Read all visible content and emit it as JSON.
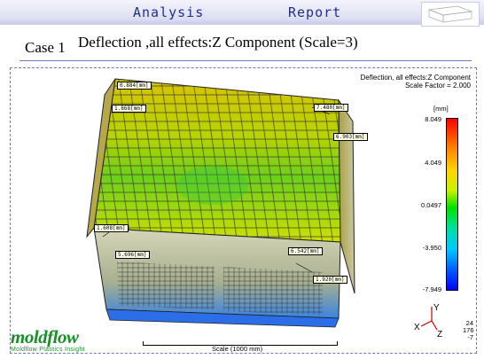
{
  "header": {
    "left_tab": "Analysis",
    "right_tab": "Report"
  },
  "title": {
    "case_label": "Case 1",
    "main": "Deflection ,all effects:Z Component (Scale=3)"
  },
  "result": {
    "title_line1": "Deflection, all effects:Z Component",
    "title_line2": "Scale Factor = 2.000",
    "unit": "[mm]",
    "legend_max": "8.049",
    "legend_ticks": [
      "8.049",
      "4.049",
      "0.0497",
      "-3.950",
      "-7.949"
    ],
    "probes": [
      "0.884[mm]",
      "1.868[mm]",
      "7.480[mm]",
      "6.903[mm]",
      "1.608[mm]",
      "5.696[mm]",
      "6.542[mm]",
      "1.920[mm]"
    ],
    "scale_text": "Scale (1000 mm)",
    "rotation": [
      "24",
      "176",
      "-7"
    ],
    "axis_labels": {
      "x": "X",
      "y": "Y",
      "z": "Z"
    }
  },
  "colors": {
    "header_text": "#1f2f8c",
    "logo": "#1a8f2a",
    "frame": "#6d7ac0"
  },
  "logo": {
    "name": "moldflow",
    "sub": "Moldflow Plastics Insight"
  }
}
